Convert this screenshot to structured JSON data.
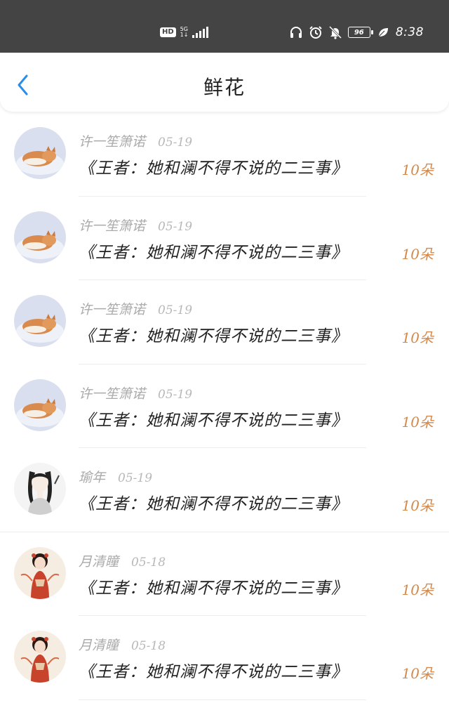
{
  "status_bar": {
    "hd_label": "HD",
    "network_type": "5G",
    "network_sub": "1↓",
    "battery_level": "96",
    "time": "8:38",
    "icons": [
      "headphones-icon",
      "alarm-icon",
      "bell-muted-icon",
      "battery-icon",
      "leaf-icon"
    ]
  },
  "header": {
    "title": "鲜花",
    "back_icon": "chevron-left-icon",
    "accent_color": "#2a8de8"
  },
  "items": [
    {
      "username": "许一笙箫诺",
      "date": "05-19",
      "book": "《王者：她和澜不得不说的二三事》",
      "count": "10朵",
      "avatar": "fox"
    },
    {
      "username": "许一笙箫诺",
      "date": "05-19",
      "book": "《王者：她和澜不得不说的二三事》",
      "count": "10朵",
      "avatar": "fox"
    },
    {
      "username": "许一笙箫诺",
      "date": "05-19",
      "book": "《王者：她和澜不得不说的二三事》",
      "count": "10朵",
      "avatar": "fox"
    },
    {
      "username": "许一笙箫诺",
      "date": "05-19",
      "book": "《王者：她和澜不得不说的二三事》",
      "count": "10朵",
      "avatar": "fox"
    },
    {
      "username": "瑜年",
      "date": "05-19",
      "book": "《王者：她和澜不得不说的二三事》",
      "count": "10朵",
      "avatar": "girl-sketch"
    },
    {
      "username": "月清瞳",
      "date": "05-18",
      "book": "《王者：她和澜不得不说的二三事》",
      "count": "10朵",
      "avatar": "girl-red"
    },
    {
      "username": "月清瞳",
      "date": "05-18",
      "book": "《王者：她和澜不得不说的二三事》",
      "count": "10朵",
      "avatar": "girl-red"
    }
  ],
  "colors": {
    "count_color": "#d4894a",
    "status_bar_bg": "#444444"
  }
}
